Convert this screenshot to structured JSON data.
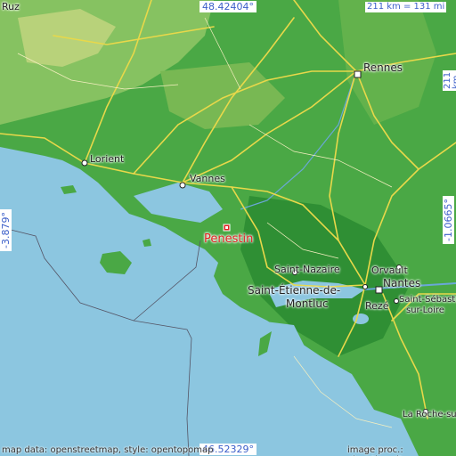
{
  "coords": {
    "top": "48.42404°",
    "bottom": "46.52329°",
    "left": "-3.879°",
    "right": "-1.0665°"
  },
  "scale": {
    "horizontal": "211 km = 131 mi",
    "vertical": "211 km = 131 mi"
  },
  "places": {
    "ruz": "Ruz",
    "rennes": "Rennes",
    "lorient": "Lorient",
    "vannes": "Vannes",
    "penestin": "Penestin",
    "saint_nazaire": "Saint-Nazaire",
    "saint_etienne": "Saint-Étienne-de-",
    "montluc": "Montluc",
    "orvault": "Orvault",
    "nantes": "Nantes",
    "reze": "Rezé",
    "saint_sebastien_1": "Saint-Sébastien-",
    "saint_sebastien_2": "sur-Loire",
    "la_roche": "La Roche-sur-"
  },
  "footer": {
    "left": "map data: openstreetmap, style: opentopomap",
    "right": "image proc.: elevation.city"
  },
  "colors": {
    "sea": "#8cc6e0",
    "land_low": "#3f9e3c",
    "land_mid": "#7fbf5a",
    "land_high": "#c8d68a",
    "highlight": "#e02020"
  }
}
